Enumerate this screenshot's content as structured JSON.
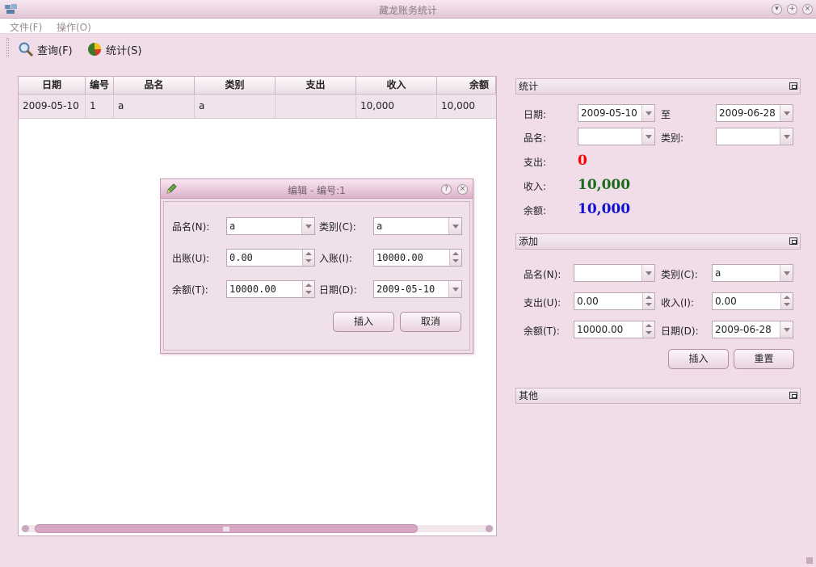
{
  "window": {
    "title": "藏龙账务统计"
  },
  "menu": {
    "items": [
      "文件(F)",
      "操作(O)"
    ]
  },
  "toolbar": {
    "query_label": "查询(F)",
    "stats_label": "统计(S)"
  },
  "table": {
    "columns": [
      "日期",
      "编号",
      "品名",
      "类别",
      "支出",
      "收入",
      "余额"
    ],
    "rows": [
      {
        "date": "2009-05-10",
        "id": "1",
        "name": "a",
        "category": "a",
        "expense": "",
        "income": "10,000",
        "balance": "10,000"
      }
    ]
  },
  "dialog": {
    "title": "编辑 - 编号:1",
    "name_label": "品名(N):",
    "name_value": "a",
    "category_label": "类别(C):",
    "category_value": "a",
    "out_label": "出账(U):",
    "out_value": "0.00",
    "in_label": "入账(I):",
    "in_value": "10000.00",
    "balance_label": "余额(T):",
    "balance_value": "10000.00",
    "date_label": "日期(D):",
    "date_value": "2009-05-10",
    "insert_label": "插入",
    "cancel_label": "取消"
  },
  "stats": {
    "header": "统计",
    "date_label": "日期:",
    "date_from": "2009-05-10",
    "to_label": "至",
    "date_to": "2009-06-28",
    "name_label": "品名:",
    "category_label": "类别:",
    "expense_label": "支出:",
    "expense_value": "0",
    "income_label": "收入:",
    "income_value": "10,000",
    "balance_label": "余额:",
    "balance_value": "10,000",
    "colors": {
      "expense": "#ff0000",
      "income": "#1a6b1a",
      "balance": "#1010d0"
    }
  },
  "add": {
    "header": "添加",
    "name_label": "品名(N):",
    "name_value": "",
    "category_label": "类别(C):",
    "category_value": "a",
    "expense_label": "支出(U):",
    "expense_value": "0.00",
    "income_label": "收入(I):",
    "income_value": "0.00",
    "balance_label": "余额(T):",
    "balance_value": "10000.00",
    "date_label": "日期(D):",
    "date_value": "2009-06-28",
    "insert_label": "插入",
    "reset_label": "重置"
  },
  "other": {
    "header": "其他"
  }
}
